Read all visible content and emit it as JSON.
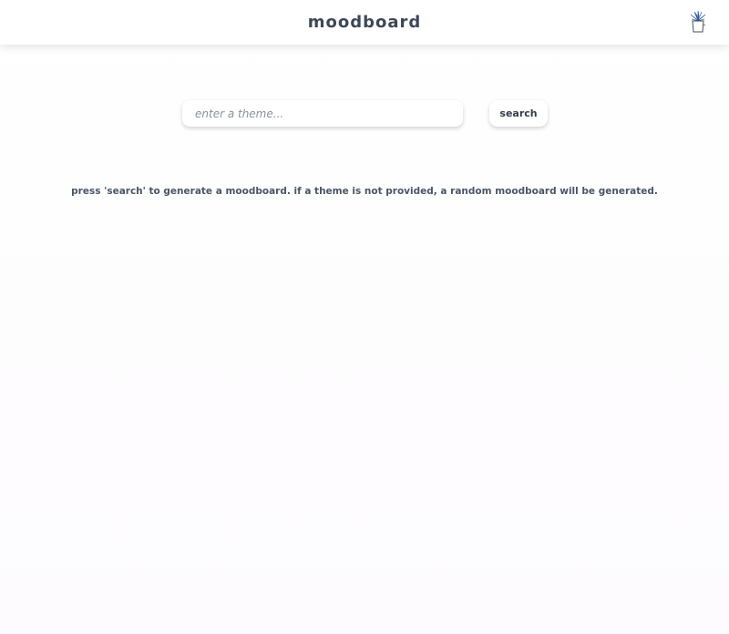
{
  "header": {
    "title": "moodboard",
    "icon": "potted-plant-icon"
  },
  "search": {
    "placeholder": "enter a theme...",
    "value": "",
    "button_label": "search"
  },
  "hint": {
    "text": "press 'search' to generate a moodboard. if a theme is not provided, a random moodboard will be generated."
  },
  "colors": {
    "text": "#3f4a5a",
    "plant_leaves": "#3b6db5",
    "background": "#fdfbfe"
  }
}
